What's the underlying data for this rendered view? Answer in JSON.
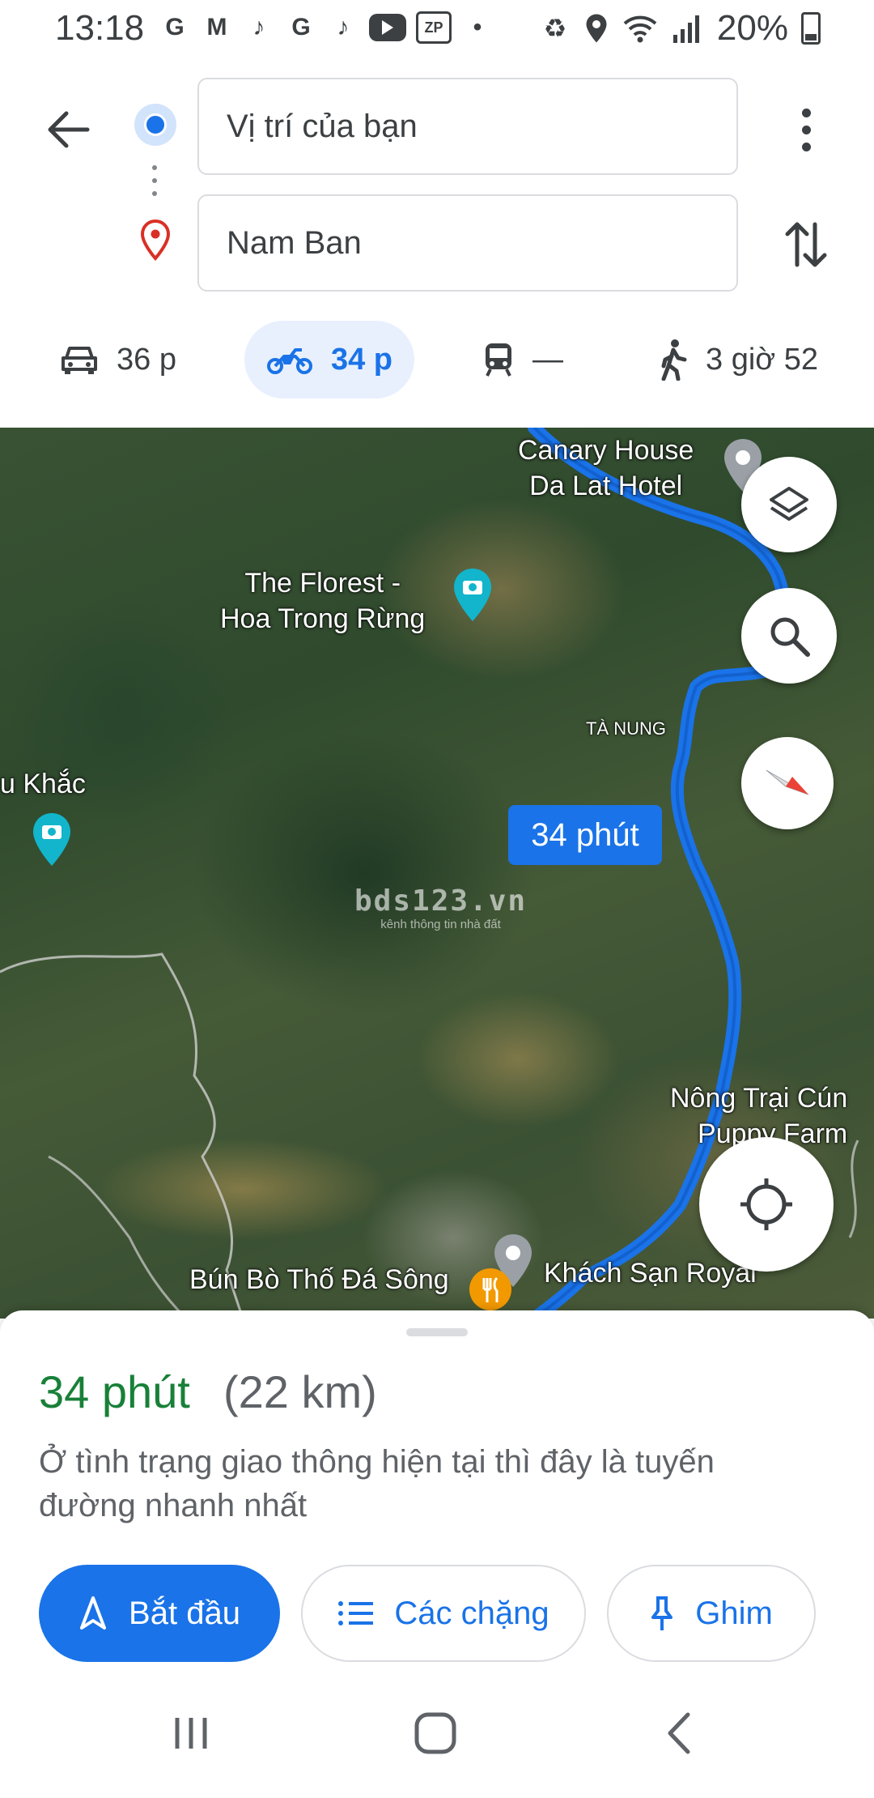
{
  "status_bar": {
    "time": "13:18",
    "apps": [
      "G",
      "M",
      "tiktok",
      "G",
      "tiktok",
      "youtube",
      "ZP",
      "•"
    ],
    "battery": "20%"
  },
  "directions": {
    "origin": "Vị trí của bạn",
    "destination": "Nam Ban",
    "modes": [
      {
        "icon": "car-icon",
        "label": "36 p",
        "selected": false
      },
      {
        "icon": "motorbike-icon",
        "label": "34 p",
        "selected": true
      },
      {
        "icon": "transit-icon",
        "label": "—",
        "selected": false
      },
      {
        "icon": "walk-icon",
        "label": "3 giờ 52",
        "selected": false
      }
    ]
  },
  "map": {
    "labels": {
      "canary": "Canary House\nDa Lat Hotel",
      "florest": "The Florest -\nHoa Trong Rừng",
      "ta_nung": "TÀ NUNG",
      "khac": "u Khắc",
      "nong_trai": "Nông Trại Cún\nPuppy Farm",
      "bun_bo": "Bún Bò Thố Đá Sông",
      "khach_san": "Khách Sạn Royal"
    },
    "eta_bubble": "34 phút",
    "watermark": {
      "line1": "bds123.vn",
      "line2": "kênh thông tin nhà đất"
    },
    "route_color": "#1a73e8"
  },
  "sheet": {
    "duration": "34 phút",
    "distance": "(22 km)",
    "description": "Ở tình trạng giao thông hiện tại thì đây là tuyến đường nhanh nhất",
    "buttons": {
      "start": "Bắt đầu",
      "steps": "Các chặng",
      "pin": "Ghim"
    }
  },
  "colors": {
    "accent": "#1a73e8",
    "duration_green": "#188038",
    "destination_red": "#d93025"
  }
}
